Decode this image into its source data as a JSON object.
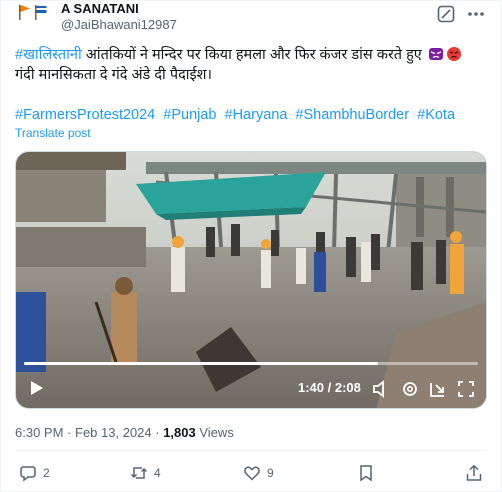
{
  "author": {
    "display_name": "A SANATANI",
    "handle": "@JaiBhawani12987"
  },
  "tweet": {
    "line1_hashtag": "#खालिस्तानी",
    "line1_text": " आंतकियों ने मन्दिर पर किया हमला और फिर कंजर डांस करते हुए ",
    "line2_text": "गंदी मानसिकता दे गंदे अंडे दी पैदाईश।",
    "hashtags": [
      "#FarmersProtest2024",
      "#Punjab",
      "#Haryana",
      "#ShambhuBorder",
      "#Kota"
    ],
    "translate_label": "Translate post"
  },
  "video": {
    "current_time": "1:40",
    "duration": "2:08",
    "time_display": "1:40 / 2:08",
    "progress": 0.78
  },
  "meta": {
    "time": "6:30 PM",
    "date": "Feb 13, 2024",
    "views_count": "1,803",
    "views_label": "Views"
  },
  "actions": {
    "replies": "2",
    "reposts": "4",
    "likes": "9"
  },
  "colors": {
    "accent": "#1d9bf0",
    "secondary_text": "#536471",
    "primary_text": "#0f1419"
  }
}
